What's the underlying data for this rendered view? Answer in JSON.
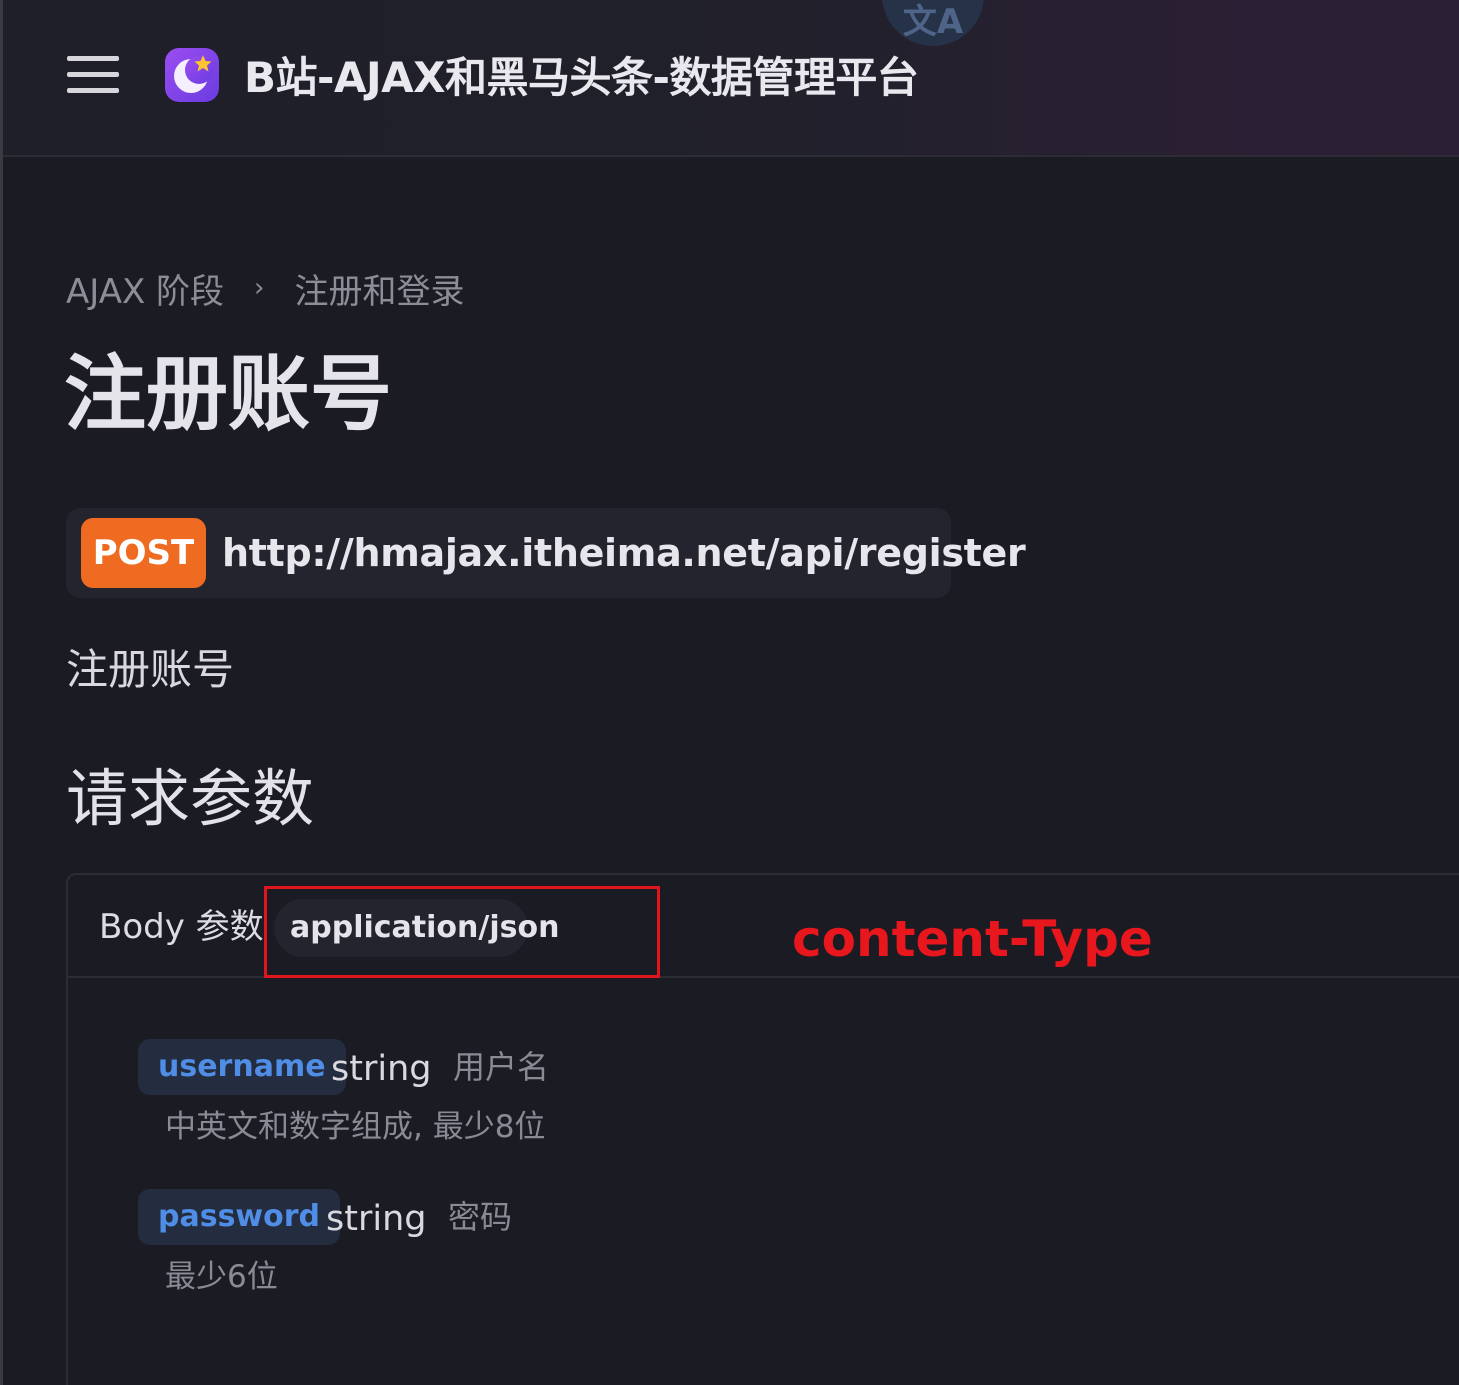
{
  "header": {
    "site_title": "B站-AJAX和黑马头条-数据管理平台",
    "translate_glyph": "文A"
  },
  "breadcrumb": {
    "items": [
      "AJAX 阶段",
      "注册和登录"
    ],
    "separator": "›"
  },
  "page": {
    "title": "注册账号",
    "description": "注册账号"
  },
  "endpoint": {
    "method": "POST",
    "url": "http://hmajax.itheima.net/api/register",
    "method_color": "#ef6b22"
  },
  "request": {
    "section_title": "请求参数",
    "body_label": "Body 参数",
    "content_type": "application/json",
    "annotation": "content-Type",
    "annotation_color": "#e8161d",
    "params": [
      {
        "name": "username",
        "type": "string",
        "label": "用户名",
        "description": "中英文和数字组成, 最少8位"
      },
      {
        "name": "password",
        "type": "string",
        "label": "密码",
        "description": "最少6位"
      }
    ]
  }
}
